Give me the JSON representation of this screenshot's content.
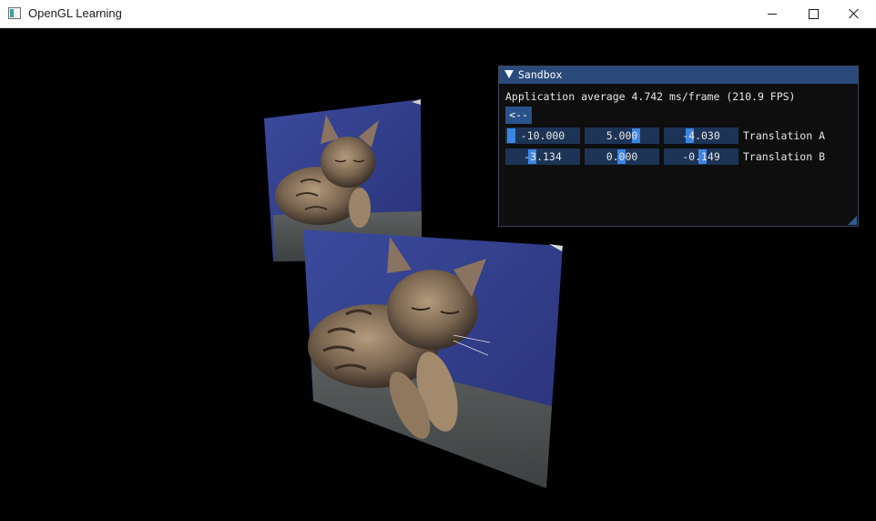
{
  "window": {
    "title": "OpenGL Learning",
    "controls": [
      "minimize",
      "maximize",
      "close"
    ],
    "background": "#000000"
  },
  "scene": {
    "objects": [
      {
        "name": "kitten-textured-quad-back",
        "image": "tabby kitten sleeping on blue background"
      },
      {
        "name": "kitten-textured-quad-front",
        "image": "tabby kitten sleeping on blue background"
      }
    ]
  },
  "sandbox": {
    "title": "Sandbox",
    "fps_text": "Application average 4.742 ms/frame (210.9 FPS)",
    "back_label": "<--",
    "translation_a": {
      "label": "Translation A",
      "values": [
        "-10.000",
        "5.000",
        "-4.030"
      ]
    },
    "translation_b": {
      "label": "Translation B",
      "values": [
        "-3.134",
        "0.000",
        "-0.149"
      ]
    }
  },
  "colors": {
    "imgui_title": "#294a7a",
    "imgui_frame": "#1d3456",
    "imgui_grab": "#3d85e0",
    "imgui_button": "#29538a"
  }
}
